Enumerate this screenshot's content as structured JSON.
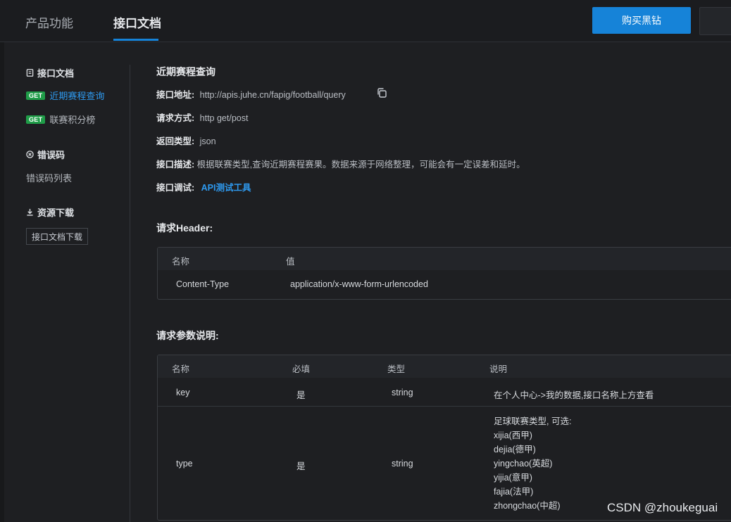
{
  "header": {
    "tabs": [
      {
        "label": "产品功能",
        "active": false
      },
      {
        "label": "接口文档",
        "active": true
      }
    ],
    "buy_button": "购买黑钻",
    "accent": "#1683d8"
  },
  "sidebar": {
    "doc_section": "接口文档",
    "doc_items": [
      {
        "badge": "GET",
        "label": "近期赛程查询",
        "active": true
      },
      {
        "badge": "GET",
        "label": "联赛积分榜",
        "active": false
      }
    ],
    "error_section": "错误码",
    "error_item": "错误码列表",
    "download_section": "资源下载",
    "download_button": "接口文档下载"
  },
  "api": {
    "title": "近期赛程查询",
    "url_label": "接口地址:",
    "url": "http://apis.juhe.cn/fapig/football/query",
    "method_label": "请求方式:",
    "method": "http get/post",
    "return_label": "返回类型:",
    "return": "json",
    "desc_label": "接口描述:",
    "desc": "根据联赛类型,查询近期赛程赛果。数据来源于网络整理，可能会有一定误差和延时。",
    "debug_label": "接口调试:",
    "debug_link": "API测试工具"
  },
  "header_table": {
    "title": "请求Header:",
    "columns": [
      "名称",
      "值"
    ],
    "rows": [
      {
        "name": "Content-Type",
        "value": "application/x-www-form-urlencoded"
      }
    ]
  },
  "params_table": {
    "title": "请求参数说明:",
    "columns": [
      "名称",
      "必填",
      "类型",
      "说明"
    ],
    "rows": [
      {
        "name": "key",
        "required": "是",
        "type": "string",
        "desc": [
          "在个人中心->我的数据,接口名称上方查看"
        ]
      },
      {
        "name": "type",
        "required": "是",
        "type": "string",
        "desc": [
          "足球联赛类型, 可选:",
          "xijia(西甲)",
          "dejia(德甲)",
          "yingchao(英超)",
          "yijia(意甲)",
          "fajia(法甲)",
          "zhongchao(中超)"
        ]
      }
    ]
  },
  "watermark": "CSDN @zhoukeguai"
}
